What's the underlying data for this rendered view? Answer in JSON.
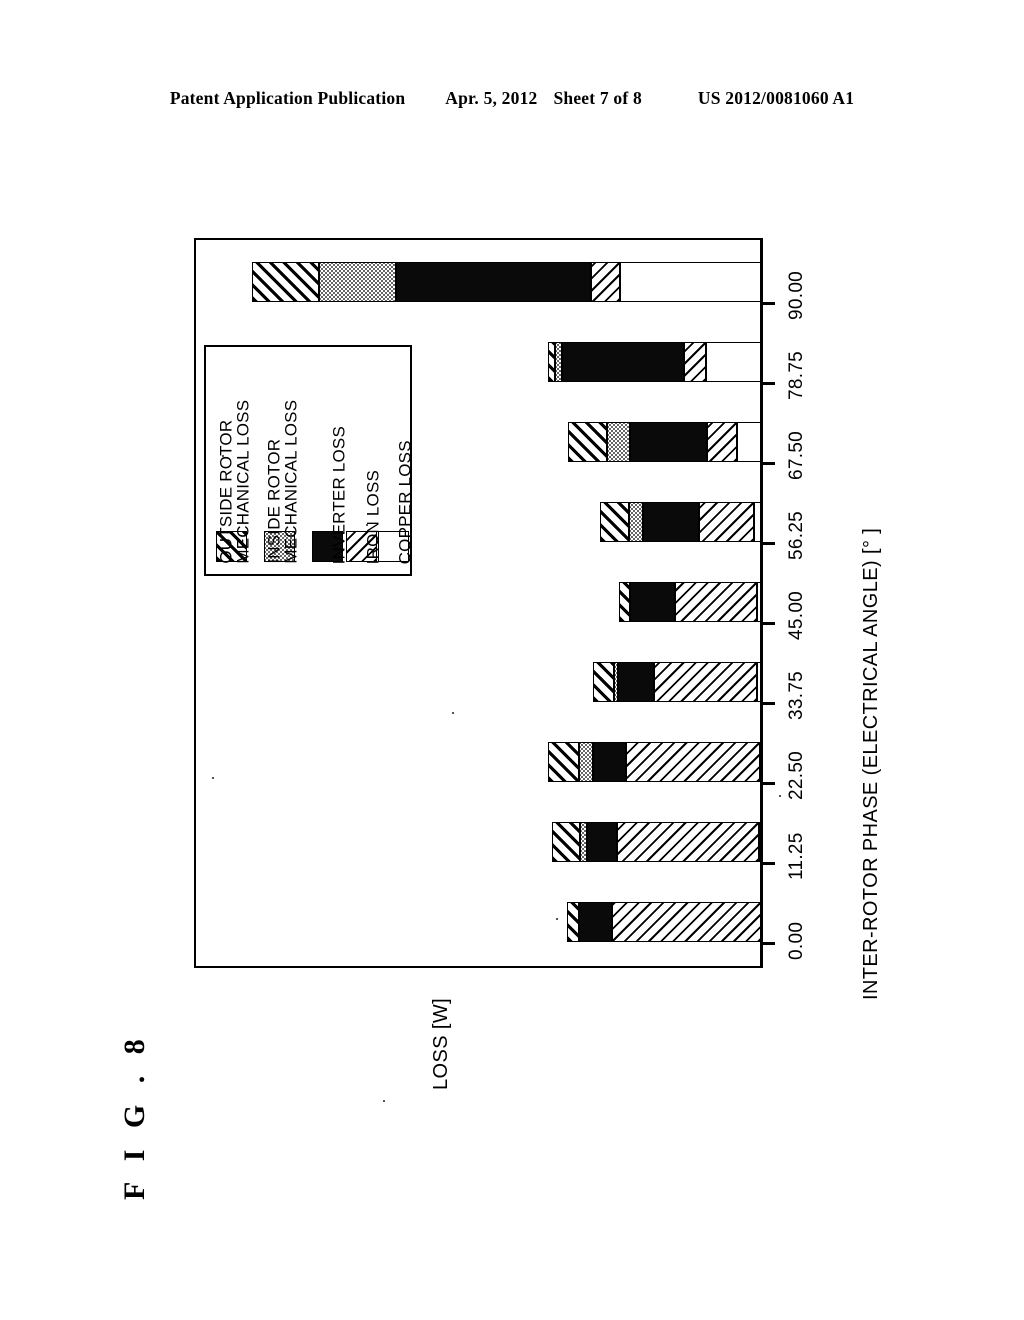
{
  "header": {
    "publication": "Patent Application Publication",
    "date": "Apr. 5, 2012",
    "sheet": "Sheet 7 of 8",
    "number": "US 2012/0081060 A1"
  },
  "figure": {
    "label": "F I G . 8"
  },
  "legend": {
    "items": [
      {
        "label_line1": "OUTSIDE ROTOR",
        "label_line2": "MECHANICAL LOSS",
        "pattern": "diagonal-hatch-bold",
        "key": "outside_rotor_mechanical"
      },
      {
        "label_line1": "INSIDE ROTOR",
        "label_line2": "MECHANICAL LOSS",
        "pattern": "dotted-stipple",
        "key": "inside_rotor_mechanical"
      },
      {
        "label_line1": "INVERTER LOSS",
        "label_line2": "",
        "pattern": "solid-black",
        "key": "inverter"
      },
      {
        "label_line1": "IRON LOSS",
        "label_line2": "",
        "pattern": "diagonal-hatch-light",
        "key": "iron"
      },
      {
        "label_line1": "COPPER LOSS",
        "label_line2": "",
        "pattern": "white-empty",
        "key": "copper"
      }
    ]
  },
  "chart_data": {
    "type": "bar",
    "orientation": "vertical-rotated",
    "stacked": true,
    "title": "",
    "xlabel": "INTER-ROTOR PHASE (ELECTRICAL ANGLE) [° ]",
    "ylabel": "LOSS [W]",
    "grid": false,
    "legend_position": "inside-upper-left",
    "categories": [
      "0.00",
      "11.25",
      "22.50",
      "33.75",
      "45.00",
      "56.25",
      "67.50",
      "78.75",
      "90.00"
    ],
    "series": [
      {
        "name": "OUTSIDE ROTOR MECHANICAL LOSS",
        "values": [
          12,
          28,
          31,
          21,
          11,
          29,
          39,
          7,
          67
        ]
      },
      {
        "name": "INSIDE ROTOR MECHANICAL LOSS",
        "values": [
          0,
          7,
          14,
          4,
          0,
          14,
          23,
          7,
          77
        ]
      },
      {
        "name": "INVERTER LOSS",
        "values": [
          33,
          30,
          33,
          36,
          45,
          56,
          77,
          122,
          195
        ]
      },
      {
        "name": "IRON LOSS",
        "values": [
          149,
          142,
          134,
          103,
          82,
          55,
          30,
          22,
          29
        ]
      },
      {
        "name": "COPPER LOSS",
        "values": [
          0,
          2,
          1,
          4,
          4,
          7,
          24,
          55,
          141
        ]
      }
    ],
    "totals": [
      194,
      209,
      213,
      168,
      142,
      161,
      193,
      213,
      509
    ],
    "ylim": [
      0,
      568
    ],
    "value_axis_ticks_shown": false
  }
}
